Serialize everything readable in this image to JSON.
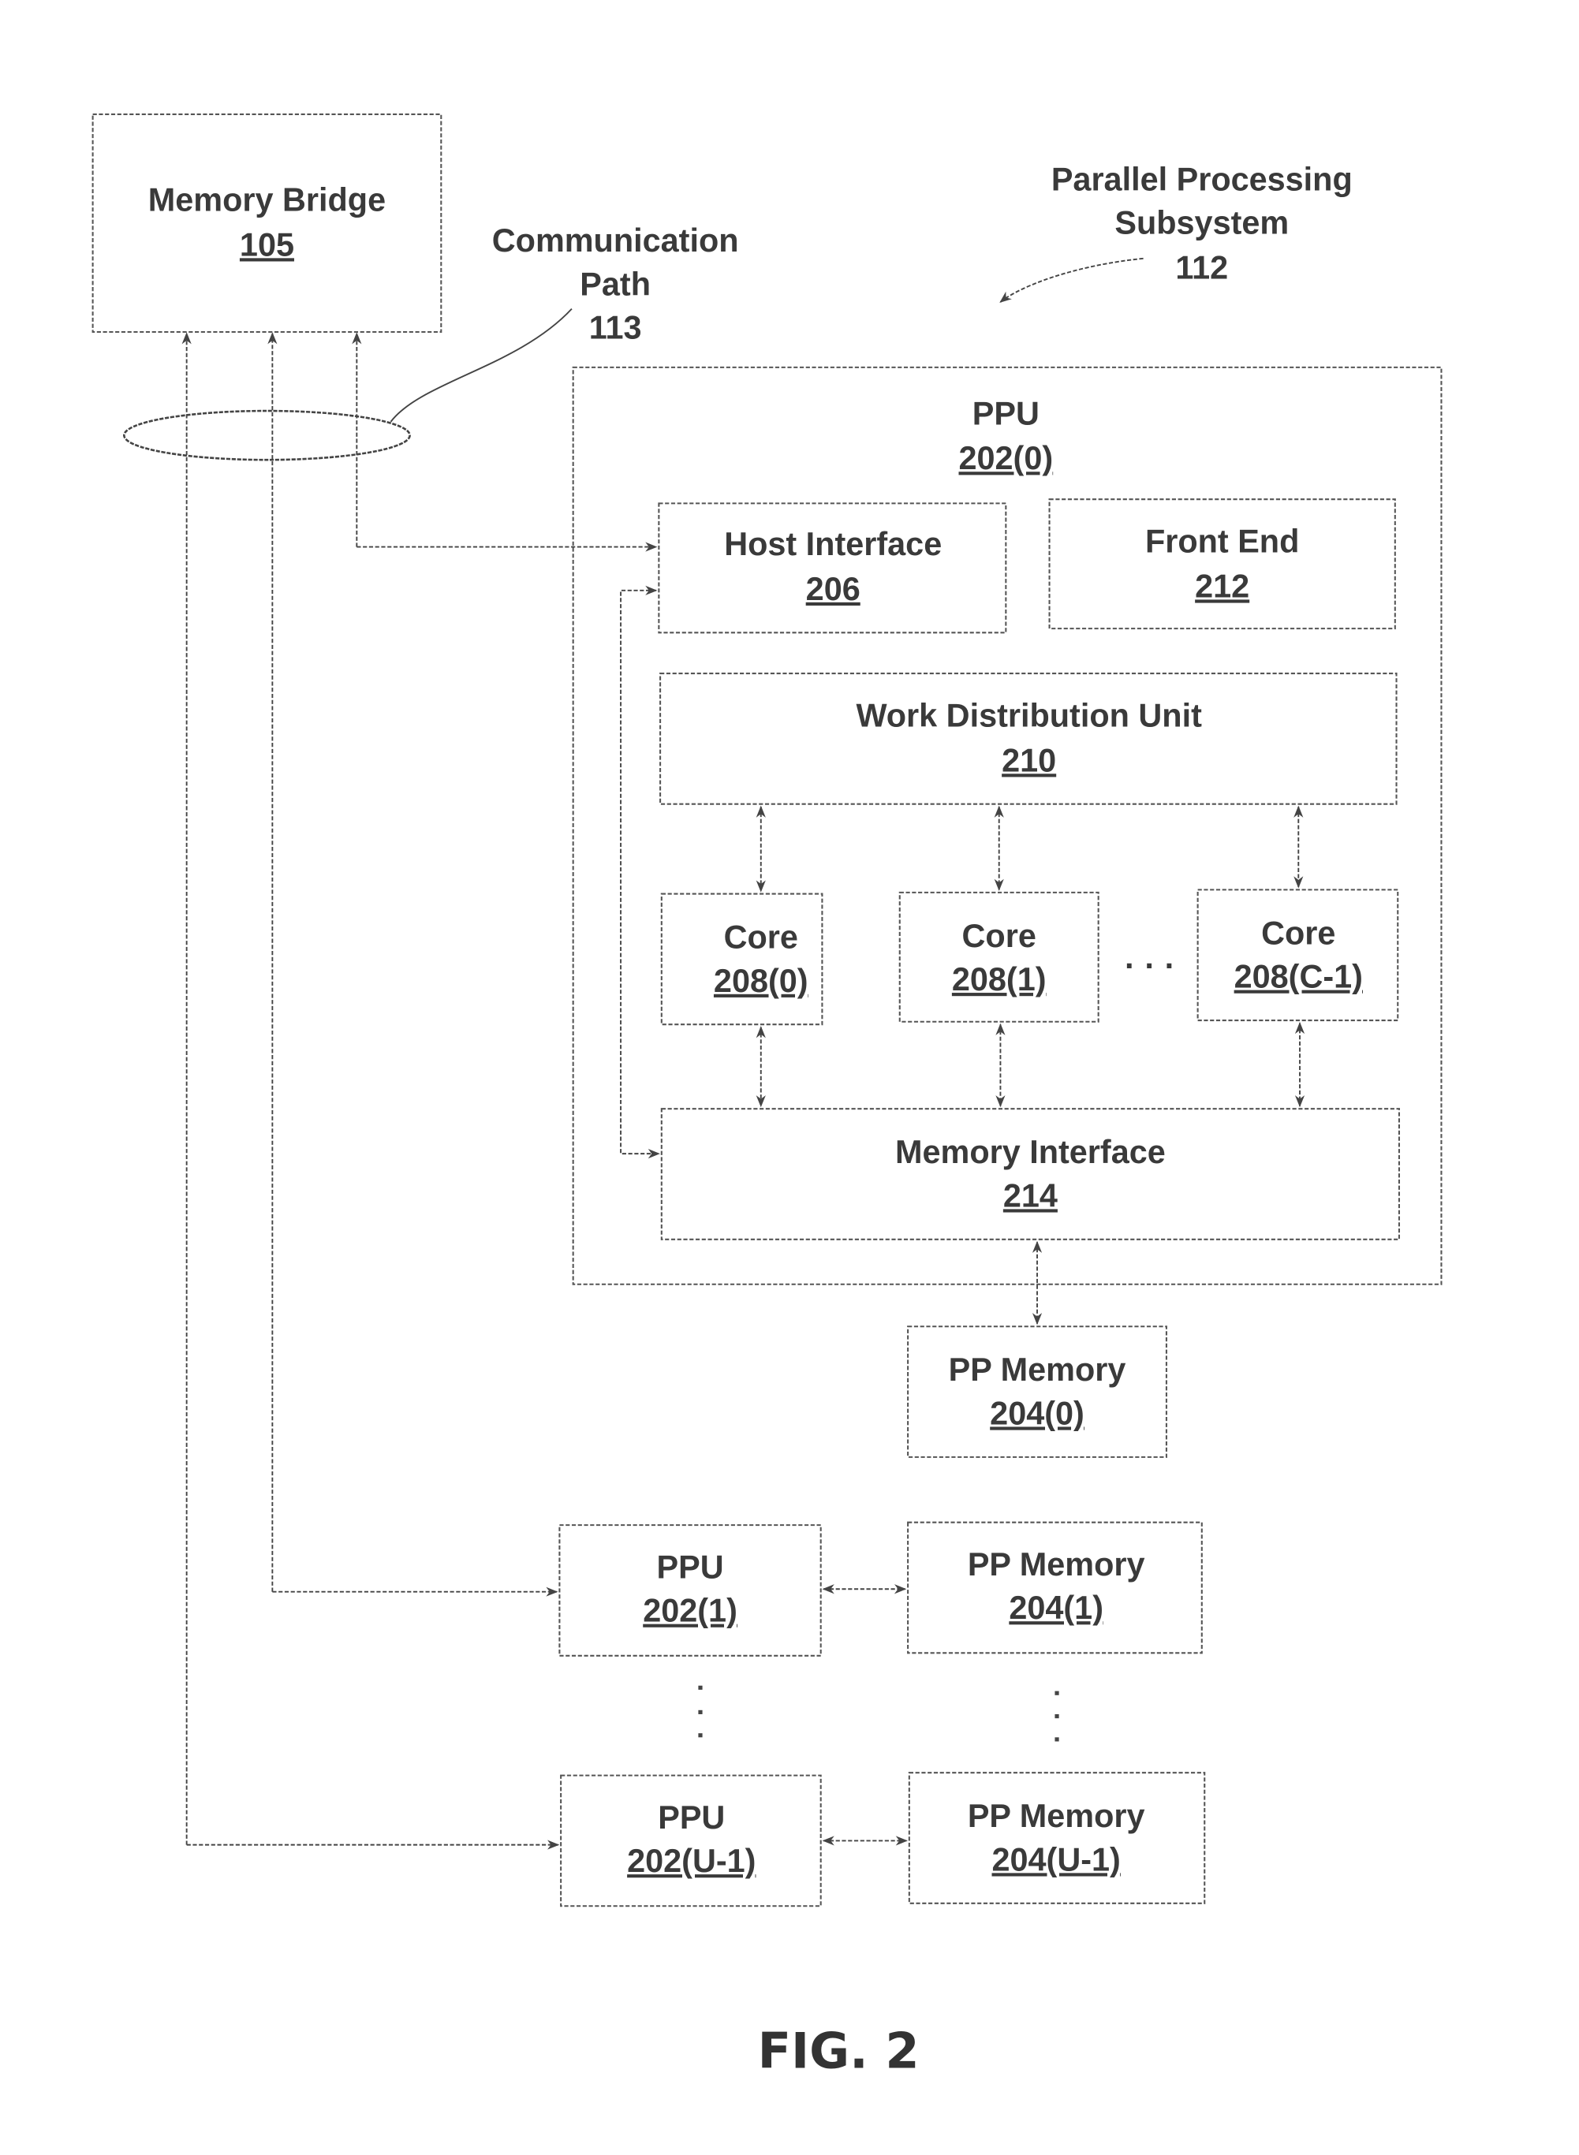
{
  "figure": {
    "caption": "FIG. 2",
    "subsystem_label": {
      "line1": "Parallel Processing",
      "line2": "Subsystem",
      "ref": "112"
    },
    "comm_path_label": {
      "line1": "Communication",
      "line2": "Path",
      "ref": "113"
    },
    "blocks": {
      "memory_bridge": {
        "title": "Memory Bridge",
        "ref": "105"
      },
      "ppu0": {
        "title": "PPU",
        "ref": "202(0)"
      },
      "host_interface": {
        "title": "Host Interface",
        "ref": "206"
      },
      "front_end": {
        "title": "Front End",
        "ref": "212"
      },
      "work_distribution": {
        "title": "Work Distribution Unit",
        "ref": "210"
      },
      "core0": {
        "title": "Core",
        "ref": "208(0)"
      },
      "core1": {
        "title": "Core",
        "ref": "208(1)"
      },
      "coreN": {
        "title": "Core",
        "ref": "208(C-1)"
      },
      "memory_interface": {
        "title": "Memory Interface",
        "ref": "214"
      },
      "pp_memory0": {
        "title": "PP Memory",
        "ref": "204(0)"
      },
      "ppu1": {
        "title": "PPU",
        "ref": "202(1)"
      },
      "pp_memory1": {
        "title": "PP Memory",
        "ref": "204(1)"
      },
      "ppuN": {
        "title": "PPU",
        "ref": "202(U-1)"
      },
      "pp_memoryN": {
        "title": "PP Memory",
        "ref": "204(U-1)"
      }
    },
    "ellipsis": "· · ·"
  }
}
